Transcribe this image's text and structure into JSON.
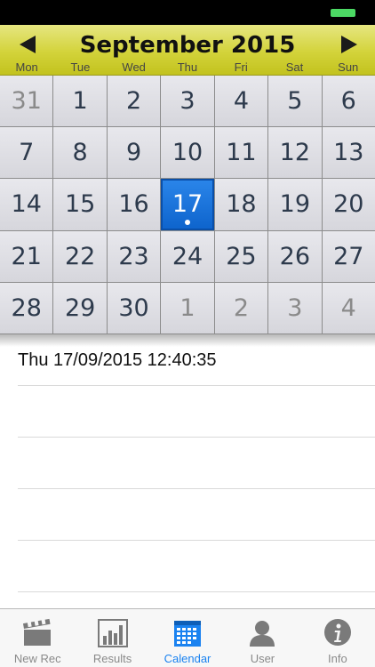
{
  "header": {
    "month_title": "September 2015",
    "weekdays": [
      "Mon",
      "Tue",
      "Wed",
      "Thu",
      "Fri",
      "Sat",
      "Sun"
    ]
  },
  "calendar": {
    "days": [
      {
        "label": "31",
        "other_month": true
      },
      {
        "label": "1"
      },
      {
        "label": "2"
      },
      {
        "label": "3"
      },
      {
        "label": "4"
      },
      {
        "label": "5"
      },
      {
        "label": "6"
      },
      {
        "label": "7"
      },
      {
        "label": "8"
      },
      {
        "label": "9"
      },
      {
        "label": "10"
      },
      {
        "label": "11"
      },
      {
        "label": "12"
      },
      {
        "label": "13"
      },
      {
        "label": "14"
      },
      {
        "label": "15"
      },
      {
        "label": "16"
      },
      {
        "label": "17",
        "selected": true,
        "has_event": true
      },
      {
        "label": "18"
      },
      {
        "label": "19"
      },
      {
        "label": "20"
      },
      {
        "label": "21"
      },
      {
        "label": "22"
      },
      {
        "label": "23"
      },
      {
        "label": "24"
      },
      {
        "label": "25"
      },
      {
        "label": "26"
      },
      {
        "label": "27"
      },
      {
        "label": "28"
      },
      {
        "label": "29"
      },
      {
        "label": "30"
      },
      {
        "label": "1",
        "other_month": true
      },
      {
        "label": "2",
        "other_month": true
      },
      {
        "label": "3",
        "other_month": true
      },
      {
        "label": "4",
        "other_month": true
      }
    ]
  },
  "events": [
    {
      "text": "Thu 17/09/2015 12:40:35"
    },
    {
      "text": ""
    },
    {
      "text": ""
    },
    {
      "text": ""
    },
    {
      "text": ""
    }
  ],
  "tab_bar": {
    "tabs": [
      {
        "label": "New Rec",
        "icon": "clapperboard-icon",
        "active": false
      },
      {
        "label": "Results",
        "icon": "bar-chart-icon",
        "active": false
      },
      {
        "label": "Calendar",
        "icon": "calendar-icon",
        "active": true
      },
      {
        "label": "User",
        "icon": "user-icon",
        "active": false
      },
      {
        "label": "Info",
        "icon": "info-icon",
        "active": false
      }
    ]
  },
  "colors": {
    "header_yellow": "#d3d33a",
    "selected_blue": "#1a76e0",
    "active_tab": "#1a82f0",
    "inactive_tab": "#8a8a8a",
    "battery_green": "#4cd964"
  }
}
